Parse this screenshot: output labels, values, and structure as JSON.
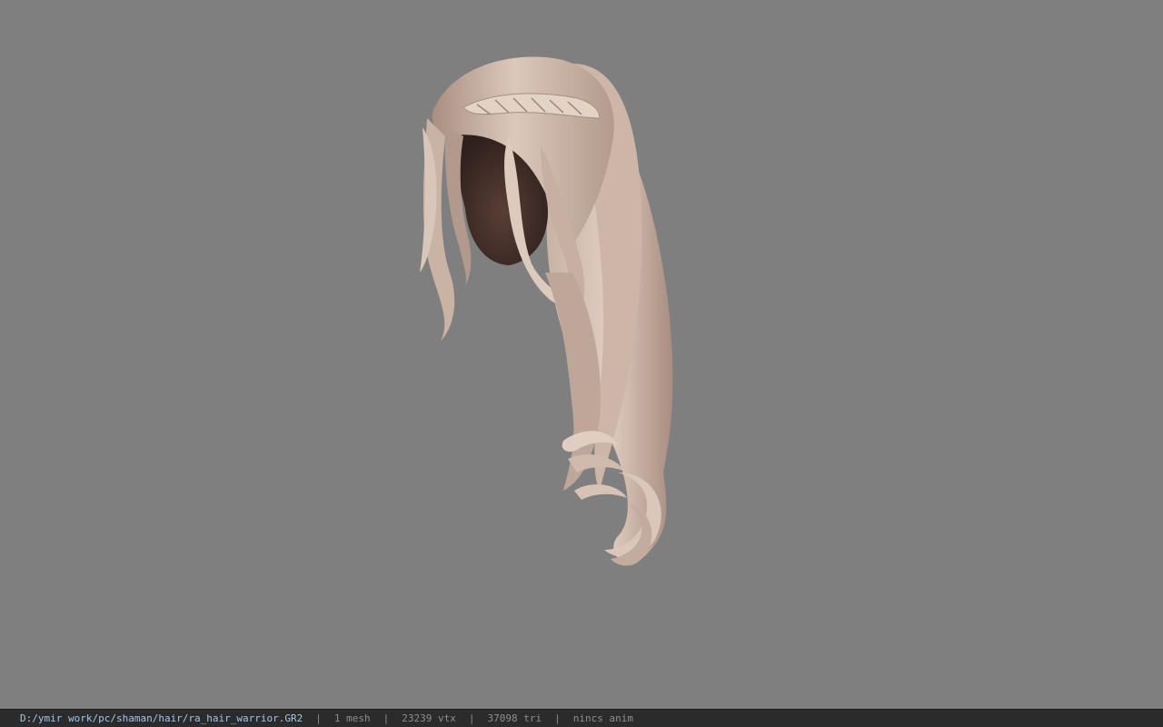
{
  "viewport": {
    "background_color": "#7f7f7f",
    "model": {
      "subject": "hair",
      "hair_color_light": "#d9c5b8",
      "hair_color_mid": "#b89e90",
      "hair_color_dark": "#4a3530"
    }
  },
  "status_bar": {
    "file_path": "D:/ymir work/pc/shaman/hair/ra_hair_warrior.GR2",
    "separator": "|",
    "mesh_count": "1 mesh",
    "vertex_count": "23239 vtx",
    "triangle_count": "37098 tri",
    "anim_status": "nincs anim",
    "path_color": "#9fc7ec",
    "background_color": "#2b2b2b"
  }
}
